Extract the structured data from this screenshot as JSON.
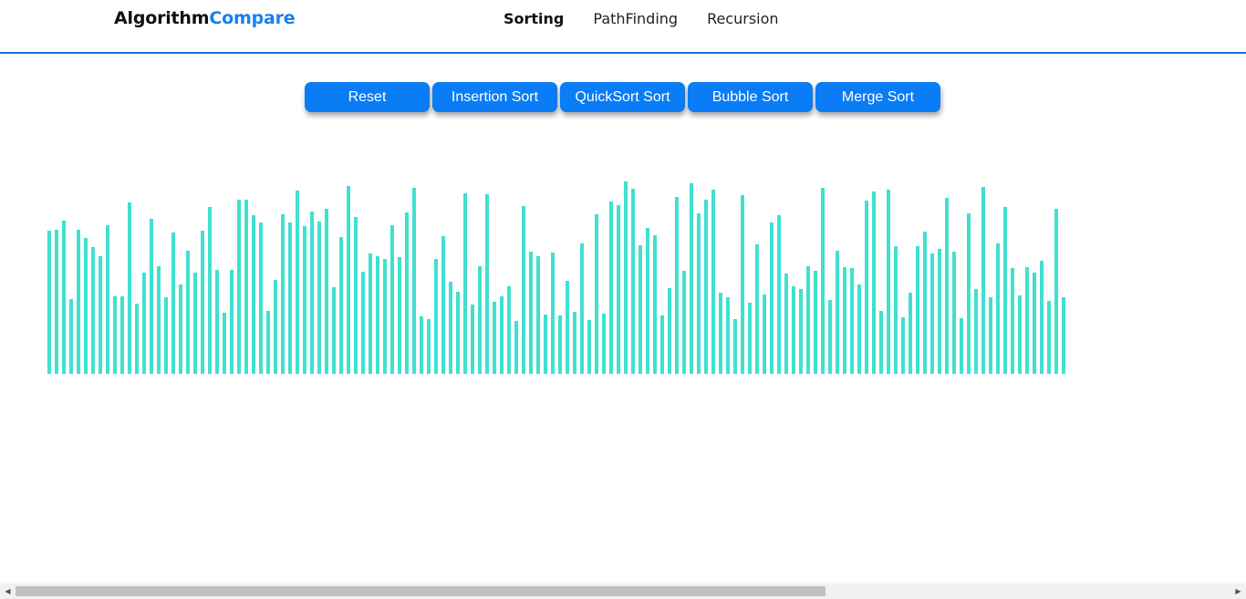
{
  "brand": {
    "part1": "Algorithm",
    "part2": "Compare"
  },
  "nav": [
    {
      "label": "Sorting",
      "active": true
    },
    {
      "label": "PathFinding",
      "active": false
    },
    {
      "label": "Recursion",
      "active": false
    }
  ],
  "buttons": {
    "reset": "Reset",
    "insertion": "Insertion Sort",
    "quicksort": "QuickSort Sort",
    "bubble": "Bubble Sort",
    "merge": "Merge Sort"
  },
  "colors": {
    "bar": "#40e0d0",
    "button": "#0a7cf5",
    "brand_accent": "#1a7ff0",
    "nav_border": "#1a73d9"
  },
  "icons": {
    "scroll_left": "scroll-left-arrow-icon",
    "scroll_right": "scroll-right-arrow-icon"
  },
  "chart_data": {
    "type": "bar",
    "values": [
      157,
      158,
      168,
      82,
      158,
      149,
      139,
      129,
      163,
      85,
      85,
      188,
      77,
      111,
      170,
      118,
      84,
      155,
      98,
      135,
      111,
      157,
      183,
      114,
      67,
      114,
      191,
      191,
      174,
      166,
      69,
      103,
      175,
      166,
      201,
      162,
      178,
      167,
      181,
      95,
      150,
      206,
      172,
      112,
      132,
      129,
      126,
      163,
      128,
      177,
      204,
      63,
      60,
      126,
      151,
      101,
      90,
      198,
      76,
      118,
      197,
      79,
      85,
      96,
      58,
      184,
      134,
      129,
      65,
      133,
      64,
      102,
      68,
      143,
      59,
      175,
      66,
      189,
      185,
      211,
      203,
      141,
      160,
      152,
      64,
      94,
      194,
      113,
      209,
      176,
      191,
      202,
      89,
      84,
      60,
      196,
      78,
      142,
      87,
      166,
      174,
      110,
      96,
      93,
      118,
      113,
      204,
      81,
      135,
      117,
      116,
      98,
      190,
      200,
      69,
      202,
      140,
      62,
      89,
      140,
      156,
      132,
      137,
      193,
      134,
      61,
      176,
      93,
      205,
      84,
      143,
      183,
      116,
      86,
      117,
      111,
      124,
      80,
      181,
      84
    ],
    "ylim": [
      0,
      220
    ]
  }
}
